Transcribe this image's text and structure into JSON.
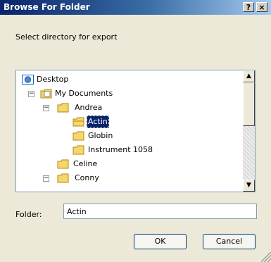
{
  "window": {
    "title": "Browse For Folder",
    "help_label": "?",
    "close_label": "×"
  },
  "description": "Select directory for export",
  "tree": {
    "nodes": [
      {
        "label": "Desktop",
        "icon": "desktop-icon",
        "expander": ""
      },
      {
        "label": "My Documents",
        "icon": "documents-folder-icon",
        "expander": "−"
      },
      {
        "label": "Andrea",
        "icon": "folder-icon",
        "expander": "−"
      },
      {
        "label": "Actin",
        "icon": "folder-icon",
        "expander": "",
        "selected": true
      },
      {
        "label": "Globin",
        "icon": "folder-icon",
        "expander": ""
      },
      {
        "label": "Instrument 1058",
        "icon": "folder-icon",
        "expander": ""
      },
      {
        "label": "Celine",
        "icon": "folder-icon",
        "expander": ""
      },
      {
        "label": "Conny",
        "icon": "folder-icon",
        "expander": "−"
      }
    ]
  },
  "folder": {
    "label": "Folder:",
    "value": "Actin"
  },
  "buttons": {
    "ok": "OK",
    "cancel": "Cancel"
  }
}
